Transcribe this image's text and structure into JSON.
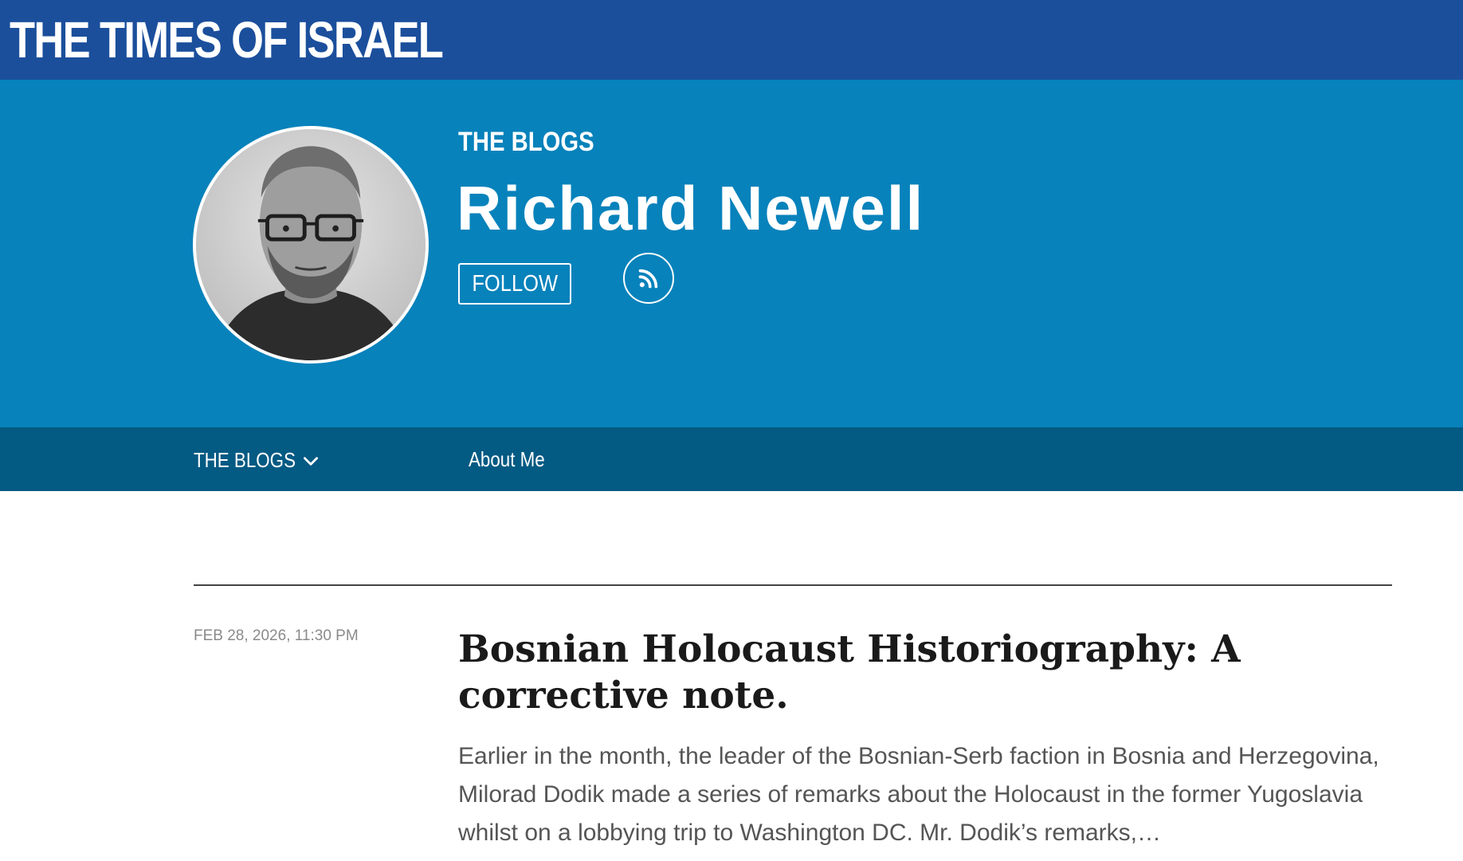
{
  "brand": {
    "logo_text": "THE TIMES OF ISRAEL",
    "bar_color": "#1b4f9c"
  },
  "hero": {
    "section_label": "THE BLOGS",
    "author_name": "Richard Newell",
    "follow_label": "FOLLOW",
    "rss_icon": "rss-icon",
    "avatar": "author-photo",
    "background_color": "#0782bb"
  },
  "subnav": {
    "blogs_label": "THE BLOGS",
    "blogs_icon": "chevron-down-icon",
    "about_label": "About Me",
    "background_color": "#035a83"
  },
  "post": {
    "date": "FEB 28, 2026, 11:30 PM",
    "title": "Bosnian Holocaust Historiography: A corrective note.",
    "excerpt": "Earlier in the month, the leader of the Bosnian-Serb faction in Bosnia and Herzegovina, Milorad Dodik made a series of remarks about the Holocaust in the former Yugoslavia whilst on a lobbying trip to Washington DC. Mr. Dodik’s remarks,…"
  }
}
